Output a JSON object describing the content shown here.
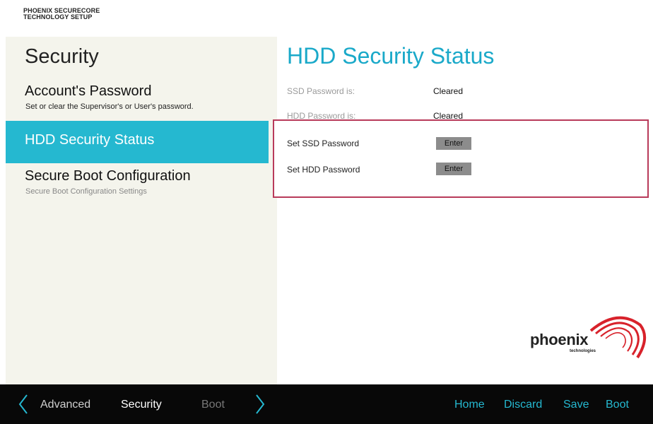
{
  "brand": {
    "line1": "PHOENIX SECURECORE",
    "line2": "TECHNOLOGY SETUP"
  },
  "left_panel": {
    "title": "Security",
    "items": [
      {
        "label": "Account's Password",
        "description": "Set or clear the Supervisor's or User's password."
      },
      {
        "label": "HDD Security Status",
        "description": ""
      },
      {
        "label": "Secure Boot Configuration",
        "description": "Secure Boot Configuration Settings"
      }
    ]
  },
  "main": {
    "title": "HDD Security Status",
    "status_rows": [
      {
        "label": "SSD Password is:",
        "value": "Cleared"
      },
      {
        "label": "HDD Password is:",
        "value": "Cleared"
      }
    ],
    "actions": [
      {
        "label": "Set SSD Password",
        "button": "Enter"
      },
      {
        "label": "Set HDD Password",
        "button": "Enter"
      }
    ]
  },
  "logo": {
    "name": "phoenix",
    "sub": "technologies",
    "icon": "phoenix-logo-icon"
  },
  "bottom_bar": {
    "tabs": [
      "Advanced",
      "Security",
      "Boot"
    ],
    "actions": [
      "Home",
      "Discard",
      "Save",
      "Boot"
    ]
  },
  "colors": {
    "accent": "#25b8d0",
    "title_accent": "#1aa9c9",
    "highlight_border": "#b83a5a",
    "panel_bg": "#f4f4ec",
    "bottom_bar_bg": "#080808",
    "logo_red": "#d8222b"
  }
}
